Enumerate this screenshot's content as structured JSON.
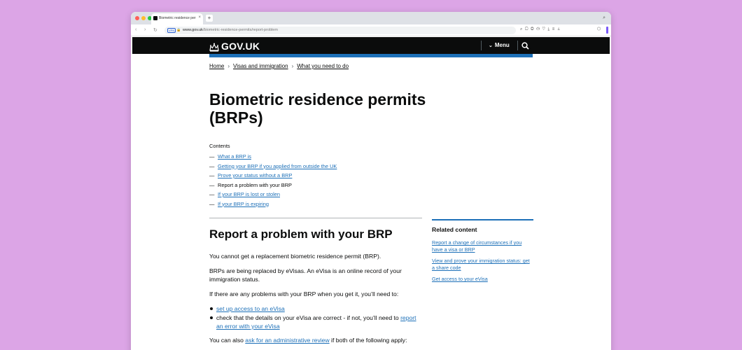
{
  "browser": {
    "tab_title": "Biometric residence per",
    "new_tab_label": "+",
    "url_host": "www.gov.uk",
    "url_path": "/biometric-residence-permits/report-problem",
    "vpn_badge": "VPN"
  },
  "header": {
    "logo_text": "GOV.UK",
    "menu_label": "Menu",
    "accent_color": "#1d70b8"
  },
  "breadcrumbs": [
    {
      "label": "Home"
    },
    {
      "label": "Visas and immigration"
    },
    {
      "label": "What you need to do"
    }
  ],
  "page_title": "Biometric residence permits (BRPs)",
  "contents": {
    "heading": "Contents",
    "items": [
      {
        "label": "What a BRP is"
      },
      {
        "label": "Getting your BRP if you applied from outside the UK"
      },
      {
        "label": "Prove your status without a BRP"
      },
      {
        "label": "Report a problem with your BRP"
      },
      {
        "label": "If your BRP is lost or stolen"
      },
      {
        "label": "If your BRP is expiring"
      }
    ]
  },
  "section": {
    "heading": "Report a problem with your BRP",
    "para1": "You cannot get a replacement biometric residence permit (BRP).",
    "para2": "BRPs are being replaced by eVisas. An eVisa is an online record of your immigration status.",
    "para3": "If there are any problems with your BRP when you get it, you’ll need to:",
    "bullet1_link": "set up access to an eVisa",
    "bullet2_text": "check that the details on your eVisa are correct - if not, you’ll need to ",
    "bullet2_link": "report an error with your eVisa",
    "para4_text": "You can also ",
    "para4_link": "ask for an administrative review",
    "para4_rest": " if both of the following apply:"
  },
  "related": {
    "heading": "Related content",
    "links": [
      {
        "label": "Report a change of circumstances if you have a visa or BRP"
      },
      {
        "label": "View and prove your immigration status: get a share code"
      },
      {
        "label": "Get access to your eVisa"
      }
    ]
  }
}
